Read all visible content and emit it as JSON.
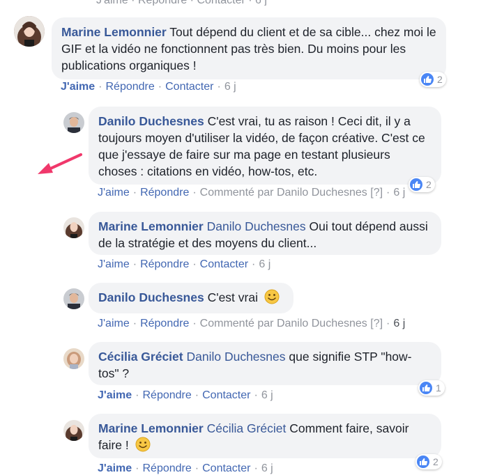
{
  "top_remnant": "J'aime · Répondre · Contacter · 6 j",
  "colors": {
    "link": "#385898",
    "like": "#4267b2",
    "bubble": "#f2f3f5",
    "meta": "#90949c",
    "arrow": "#f0386b"
  },
  "comments": [
    {
      "author": "Marine Lemonnier",
      "text": "Tout dépend du client et de sa cible... chez moi le GIF et la vidéo ne fonctionnent pas très bien. Du moins pour les publications organiques !",
      "like": "J'aime",
      "reply": "Répondre",
      "extra": "Contacter",
      "time": "6 j",
      "reactions": "2"
    },
    {
      "author": "Danilo Duchesnes",
      "text": "C'est vrai, tu as raison ! Ceci dit, il y a toujours moyen d'utiliser la vidéo, de façon créative. C'est ce que j'essaye de faire sur ma page en testant plusieurs choses : citations en vidéo, how-tos, etc.",
      "like": "J'aime",
      "reply": "Répondre",
      "extra": "Commenté par Danilo Duchesnes",
      "help": "[?]",
      "time": "6 j",
      "reactions": "2"
    },
    {
      "author": "Marine Lemonnier",
      "mention": "Danilo Duchesnes",
      "text": "Oui tout dépend aussi de la stratégie et des moyens du client...",
      "like": "J'aime",
      "reply": "Répondre",
      "extra": "Contacter",
      "time": "6 j"
    },
    {
      "author": "Danilo Duchesnes",
      "text": "C'est vrai",
      "emoji": "smiley-icon",
      "like": "J'aime",
      "reply": "Répondre",
      "extra": "Commenté par Danilo Duchesnes",
      "help": "[?]",
      "time": "6 j"
    },
    {
      "author": "Cécilia Gréciet",
      "mention": "Danilo Duchesnes",
      "text": "que signifie STP \"how-tos\" ?",
      "like": "J'aime",
      "reply": "Répondre",
      "extra": "Contacter",
      "time": "6 j",
      "reactions": "1"
    },
    {
      "author": "Marine Lemonnier",
      "mention": "Cécilia Gréciet",
      "text": "Comment faire, savoir faire !",
      "emoji": "smiley-icon",
      "like": "J'aime",
      "reply": "Répondre",
      "extra": "Contacter",
      "time": "6 j",
      "reactions": "2"
    }
  ]
}
